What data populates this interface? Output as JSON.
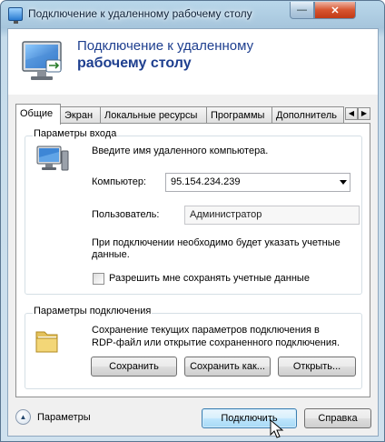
{
  "window": {
    "title": "Подключение к удаленному рабочему столу",
    "minimize_glyph": "—",
    "close_glyph": "✕"
  },
  "header": {
    "title_line1": "Подключение к удаленному",
    "title_line2": "рабочему столу"
  },
  "tabs": [
    {
      "label": "Общие",
      "active": true
    },
    {
      "label": "Экран"
    },
    {
      "label": "Локальные ресурсы"
    },
    {
      "label": "Программы"
    },
    {
      "label": "Дополнитель"
    }
  ],
  "tab_scroll": {
    "left_glyph": "◀",
    "right_glyph": "▶"
  },
  "login_group": {
    "title": "Параметры входа",
    "prompt": "Введите имя удаленного компьютера.",
    "computer_label": "Компьютер:",
    "computer_value": "95.154.234.239",
    "user_label": "Пользователь:",
    "user_value": "Администратор",
    "note_line1": "При подключении необходимо будет указать учетные",
    "note_line2": "данные.",
    "save_credentials_label": "Разрешить мне сохранять учетные данные",
    "save_credentials_checked": false
  },
  "connection_group": {
    "title": "Параметры подключения",
    "desc_line1": "Сохранение текущих параметров подключения в",
    "desc_line2": "RDP-файл или открытие сохраненного подключения.",
    "save_button": "Сохранить",
    "save_as_button": "Сохранить как...",
    "open_button": "Открыть..."
  },
  "footer": {
    "options_label": "Параметры",
    "expand_glyph": "▲",
    "connect_button": "Подключить",
    "help_button": "Справка"
  },
  "colors": {
    "header_title": "#1e3f8f",
    "default_button_border": "#3c7fb1"
  }
}
